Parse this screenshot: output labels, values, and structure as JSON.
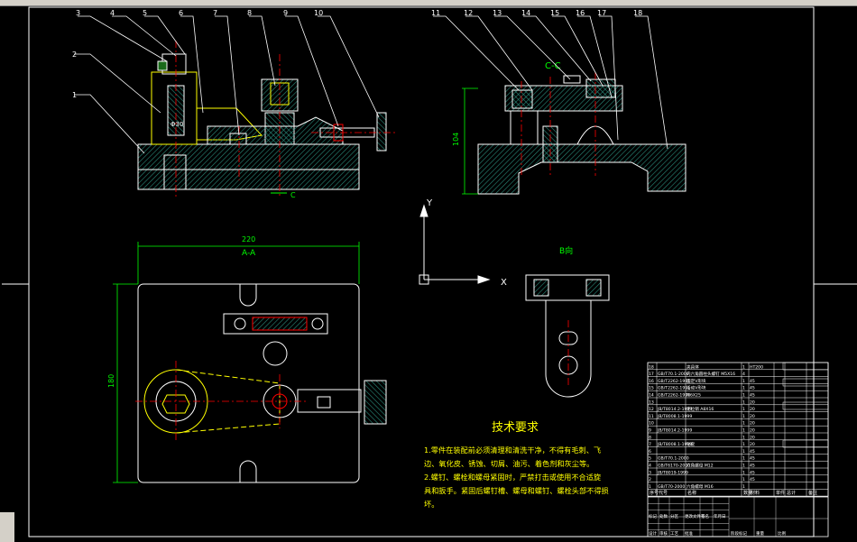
{
  "balloons": [
    "1",
    "2",
    "3",
    "4",
    "5",
    "6",
    "7",
    "8",
    "9",
    "10",
    "11",
    "12",
    "13",
    "14",
    "15",
    "16",
    "17",
    "18"
  ],
  "view_labels": {
    "section_cc": "C-C",
    "section_aa": "A-A",
    "view_b": "B向",
    "c_marker": "C"
  },
  "dimensions": {
    "width_top": "220",
    "height_left": "180",
    "height_side": "104",
    "dia": "Φ30"
  },
  "ucs": {
    "x": "X",
    "y": "Y"
  },
  "tech_req": {
    "title": "技术要求",
    "lines": [
      "1.零件在装配前必须清理和清洗干净，不得有毛刺、飞",
      "边、氧化皮、锈蚀、切屑、油污、着色剂和灰尘等。",
      "2.螺钉、螺栓和螺母紧固时，严禁打击或使用不合适旋",
      "具和扳手。紧固后螺钉槽、螺母和螺钉、螺栓头部不得损",
      "坏。"
    ]
  },
  "bom_header": [
    "序号",
    "代号",
    "名称",
    "数量",
    "材料",
    "单件",
    "总计",
    "备注"
  ],
  "bom_rows": [
    {
      "no": "18",
      "code": "",
      "name": "夹具体",
      "qty": "1",
      "mat": "HT200"
    },
    {
      "no": "17",
      "code": "GB/T70.1-2000",
      "name": "内六角圆柱头螺钉 M5X16",
      "qty": "4",
      "mat": ""
    },
    {
      "no": "16",
      "code": "GB/T2262-1991",
      "name": "固定V形块",
      "qty": "1",
      "mat": "45"
    },
    {
      "no": "15",
      "code": "GB/T2262-1991",
      "name": "活动V形块",
      "qty": "1",
      "mat": "45"
    },
    {
      "no": "14",
      "code": "GB/T2262-1991",
      "name": "M6X25",
      "qty": "1",
      "mat": "45"
    },
    {
      "no": "13",
      "code": "",
      "name": "",
      "qty": "1",
      "mat": "20"
    },
    {
      "no": "12",
      "code": "JB/T8014.2-1999",
      "name": "定位销 A8X16",
      "qty": "1",
      "mat": "20"
    },
    {
      "no": "11",
      "code": "JB/T8008.1-1999",
      "name": "",
      "qty": "1",
      "mat": "20"
    },
    {
      "no": "10",
      "code": "",
      "name": "",
      "qty": "1",
      "mat": "20"
    },
    {
      "no": "9",
      "code": "JB/T8014.2-1999",
      "name": "",
      "qty": "1",
      "mat": "20"
    },
    {
      "no": "8",
      "code": "",
      "name": "",
      "qty": "1",
      "mat": "20"
    },
    {
      "no": "7",
      "code": "JB/T8008.1-1999",
      "name": "钻套",
      "qty": "1",
      "mat": "20"
    },
    {
      "no": "6",
      "code": "",
      "name": "",
      "qty": "1",
      "mat": "45"
    },
    {
      "no": "5",
      "code": "GB/T70.1-2000",
      "name": "",
      "qty": "1",
      "mat": "45"
    },
    {
      "no": "4",
      "code": "GB/T6170-2000",
      "name": "六角螺母 M12",
      "qty": "1",
      "mat": "45"
    },
    {
      "no": "3",
      "code": "JB/T8019-1999",
      "name": "",
      "qty": "1",
      "mat": "45"
    },
    {
      "no": "2",
      "code": "",
      "name": "",
      "qty": "1",
      "mat": "45"
    },
    {
      "no": "1",
      "code": "GB/T70-2000",
      "name": "六角螺母 M16",
      "qty": "1",
      "mat": ""
    }
  ],
  "title_block": [
    "标记",
    "处数",
    "分区",
    "更改文件号",
    "签名",
    "年月日",
    "设计",
    "审核",
    "工艺",
    "批准",
    "阶段标记",
    "重量",
    "比例"
  ]
}
